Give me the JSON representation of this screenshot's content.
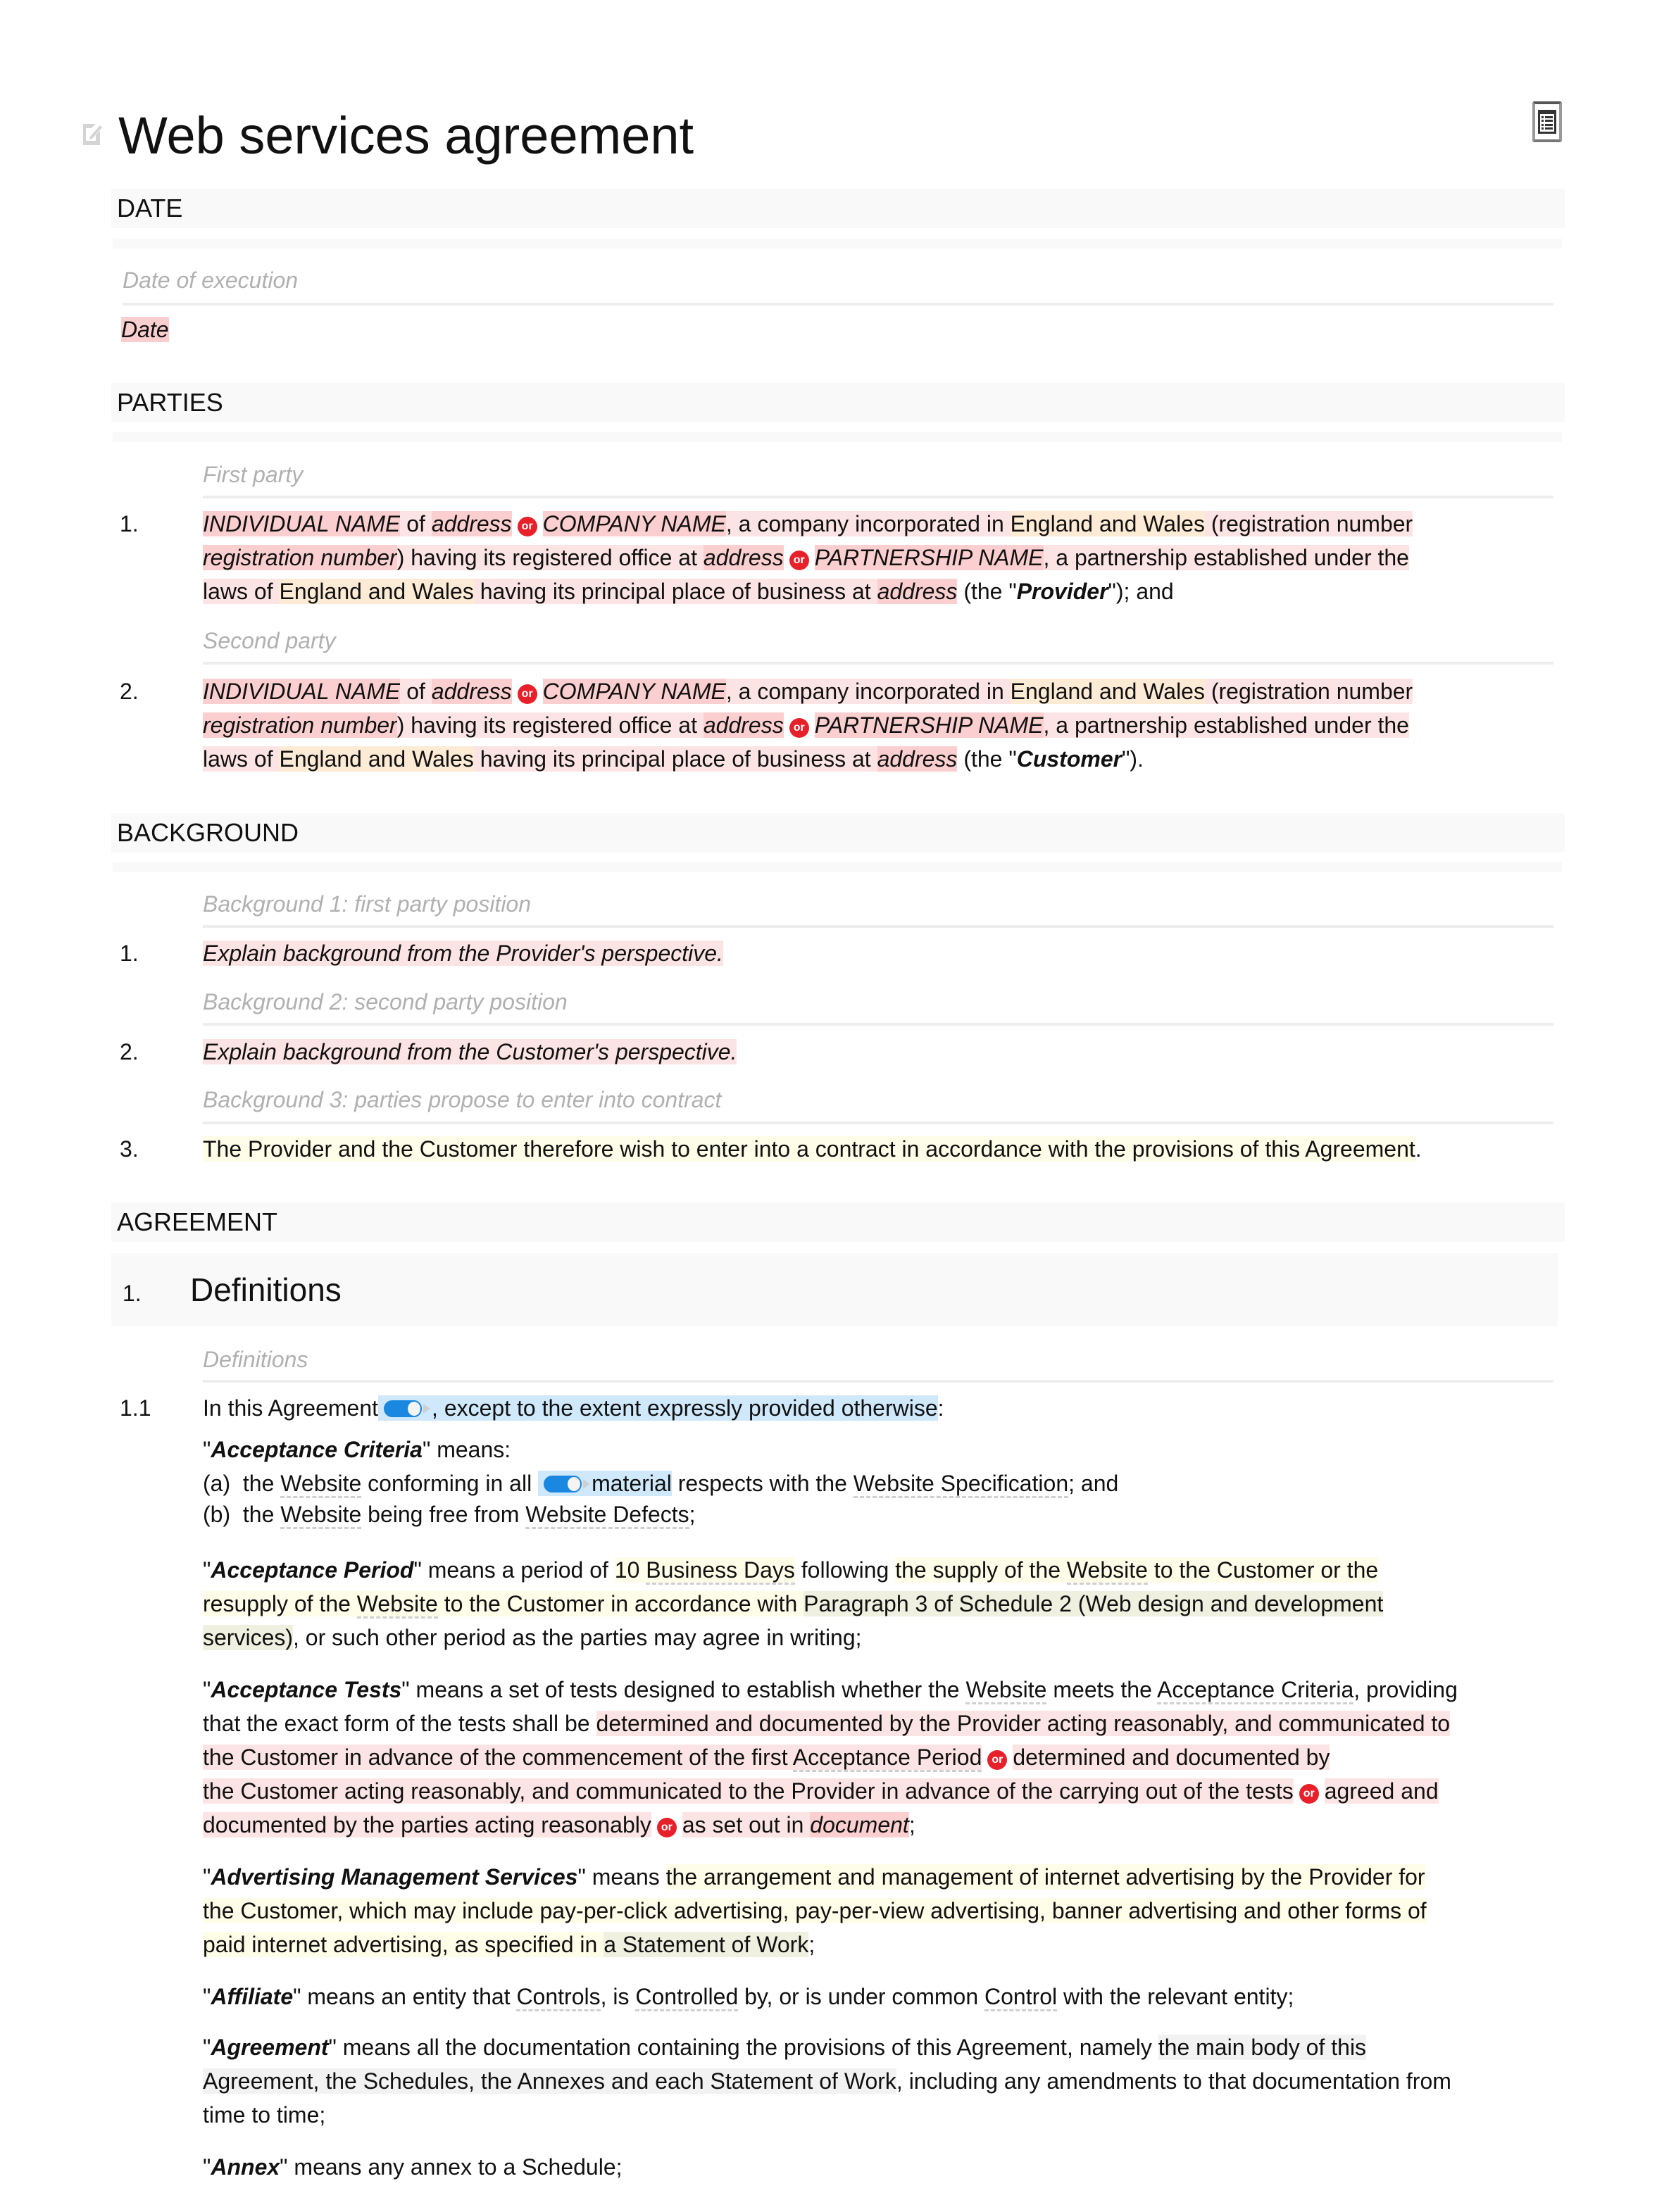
{
  "document": {
    "title": "Web services agreement",
    "toc_button_label": "Table of contents",
    "edit_icon": "edit-pencil-icon"
  },
  "sections": {
    "date": {
      "header": "DATE",
      "label": "Date of execution",
      "value": "Date"
    },
    "parties": {
      "header": "PARTIES",
      "first_label": "First party",
      "second_label": "Second party",
      "items": [
        {
          "number": "1.",
          "individual_name": "INDIVIDUAL NAME",
          "of": " of ",
          "address1": "address",
          "or": "or",
          "company_name": "COMPANY NAME",
          "company_text": ", a company incorporated in ",
          "jurisdiction1": "England and Wales",
          "reg_text": " (registration number ",
          "reg_number": "registration number",
          "office_text": ") having its registered office at ",
          "address2": "address",
          "partnership_name": "PARTNERSHIP NAME",
          "partnership_text": ", a partnership established under the",
          "laws_text": "laws of ",
          "jurisdiction2": "England and Wales",
          "business_text": " having its principal place of business at ",
          "address3": "address",
          "the_open": " (the \"",
          "defined_term": "Provider",
          "the_close": "\"); and"
        },
        {
          "number": "2.",
          "individual_name": "INDIVIDUAL NAME",
          "of": " of ",
          "address1": "address",
          "or": "or",
          "company_name": "COMPANY NAME",
          "company_text": ", a company incorporated in ",
          "jurisdiction1": "England and Wales",
          "reg_text": " (registration number ",
          "reg_number": "registration number",
          "office_text": ") having its registered office at ",
          "address2": "address",
          "partnership_name": "PARTNERSHIP NAME",
          "partnership_text": ", a partnership established under the",
          "laws_text": "laws of ",
          "jurisdiction2": "England and Wales",
          "business_text": " having its principal place of business at ",
          "address3": "address",
          "the_open": " (the \"",
          "defined_term": "Customer",
          "the_close": "\")."
        }
      ]
    },
    "background": {
      "header": "BACKGROUND",
      "items": [
        {
          "label": "Background 1: first party position",
          "number": "1.",
          "text": "Explain background from the Provider's perspective."
        },
        {
          "label": "Background 2: second party position",
          "number": "2.",
          "text": "Explain background from the Customer's perspective."
        },
        {
          "label": "Background 3: parties propose to enter into contract",
          "number": "3.",
          "text": "The Provider and the Customer therefore wish to enter into a contract in accordance with the provisions of this Agreement",
          "end": "."
        }
      ]
    },
    "agreement": {
      "header": "AGREEMENT",
      "clause_number": "1.",
      "clause_title": "Definitions",
      "label": "Definitions",
      "sub_number": "1.1",
      "intro": {
        "lead": "In this Agreement",
        "toggle_on": true,
        "rest": ", except to the extent expressly provided otherwise",
        "end": ":"
      },
      "acceptance_criteria": {
        "open": "\"",
        "term": "Acceptance Criteria",
        "close": "\" means:",
        "a_prefix": "(a)  the ",
        "a_website": "Website",
        "a_mid": " conforming in all ",
        "a_toggle_on": true,
        "a_material": "material",
        "a_rest": " respects with the ",
        "a_spec": "Website Specification",
        "a_end": "; and",
        "b_prefix": "(b)  the ",
        "b_website": "Website",
        "b_mid": " being free from ",
        "b_defects": "Website Defects",
        "b_end": ";"
      },
      "acceptance_period": {
        "term": "Acceptance Period",
        "means": "\" means a period of ",
        "days_num": "10 ",
        "days": "Business Days",
        "following": " following ",
        "supply": "the supply of the ",
        "website": "Website",
        "supply_rest": " to the Customer or the",
        "resupply": "resupply of the ",
        "website2": "Website",
        "resupply_rest": " to the Customer in accordance with ",
        "paragraph": "Paragraph 3 of Schedule 2 (Web design and development",
        "services": "services)",
        "tail": ", or such other period as the parties may agree in writing;"
      },
      "acceptance_tests": {
        "term": "Acceptance Tests",
        "means": "\" means a set of tests designed to establish whether the ",
        "website": "Website",
        "meets": " meets the ",
        "criteria": "Acceptance Criteria",
        "providing": ", providing",
        "that": "that the exact form of the tests shall be ",
        "opt1_l1": "determined and documented by the Provider acting reasonably, and communicated to",
        "opt1_l2": "the Customer in advance of the commencement of the first ",
        "opt1_period": "Acceptance Period",
        "or": "or",
        "opt2_l1": "determined and documented by",
        "opt2_l2": "the Customer acting reasonably, and communicated to the Provider in advance of the carrying out of the tests",
        "opt3_l1": "agreed and",
        "opt3_l2": "documented by the parties acting reasonably",
        "opt4": "as set out in ",
        "document": "document",
        "end": ";"
      },
      "advertising": {
        "term": "Advertising Management Services",
        "means": "\" means ",
        "l1": "the arrangement and management of internet advertising by the Provider for",
        "l2": "the Customer, which may include pay-per-click advertising, pay-per-view advertising, banner advertising and other forms of",
        "l3": "paid internet advertising, as specified in ",
        "sow": "a Statement of Work",
        "end": ";"
      },
      "affiliate": {
        "term": "Affiliate",
        "means": "\" means an entity that ",
        "controls": "Controls",
        "mid": ", is ",
        "controlled": "Controlled",
        "mid2": " by, or is under common ",
        "control": "Control",
        "end": " with the relevant entity;"
      },
      "agreement_def": {
        "term": "Agreement",
        "means": "\" means all the documentation containing the provisions of this Agreement, namely ",
        "hl1": "the main body of this",
        "hl2": "Agreement, the Schedules, the Annexes and each Statement of Work",
        "rest": ", including any amendments to that documentation from",
        "l3": "time to time;"
      },
      "annex": {
        "term": "Annex",
        "means": "\" means any annex to a Schedule;"
      }
    }
  },
  "colors": {
    "placeholder_red": "#fbcfcf",
    "optional_pink": "#fde4e4",
    "jurisdiction_orange": "#fdebd6",
    "editable_yellow": "#fefde8",
    "cross_ref_olive": "#f0f0e0",
    "toggle_blue": "#1a88e0",
    "or_badge": "#e8202a"
  }
}
